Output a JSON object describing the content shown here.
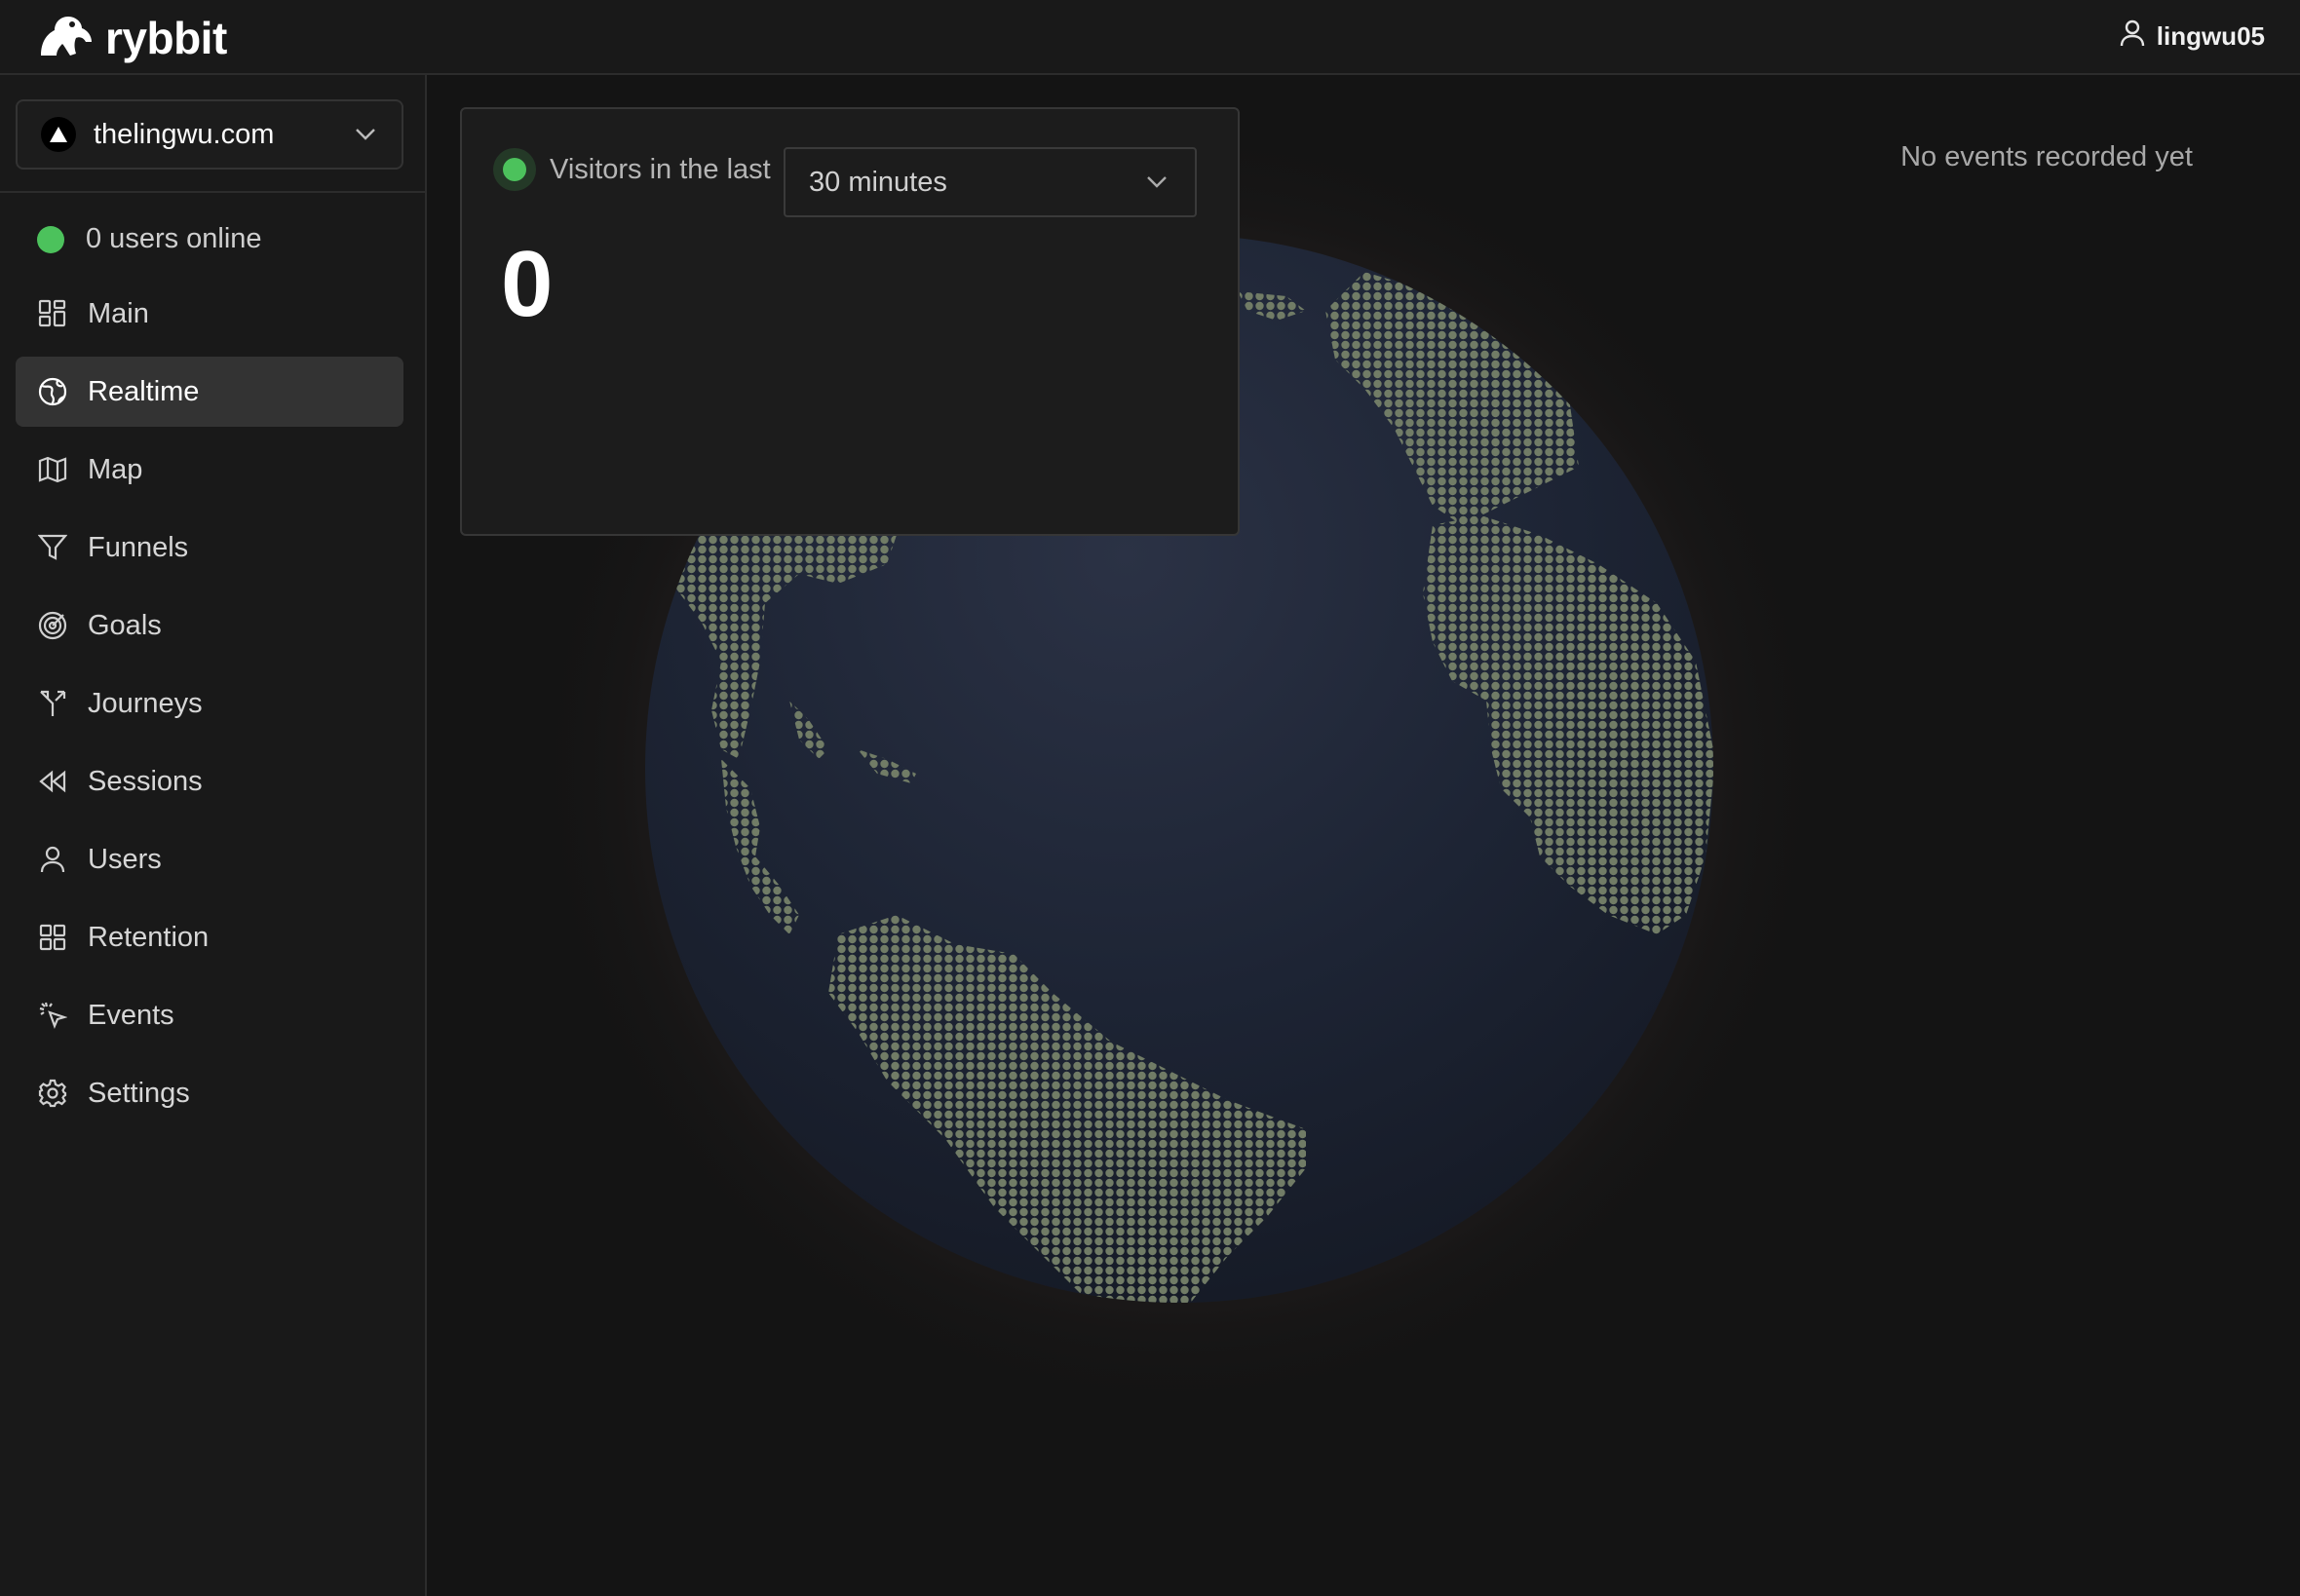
{
  "app": {
    "name": "rybbit"
  },
  "header": {
    "username": "lingwu05"
  },
  "sidebar": {
    "site": {
      "name": "thelingwu.com"
    },
    "online_text": "0 users online",
    "items": [
      {
        "label": "Main",
        "icon": "grid-icon"
      },
      {
        "label": "Realtime",
        "icon": "globe-icon",
        "active": true
      },
      {
        "label": "Map",
        "icon": "map-icon"
      },
      {
        "label": "Funnels",
        "icon": "funnel-icon"
      },
      {
        "label": "Goals",
        "icon": "target-icon"
      },
      {
        "label": "Journeys",
        "icon": "split-icon"
      },
      {
        "label": "Sessions",
        "icon": "rewind-icon"
      },
      {
        "label": "Users",
        "icon": "user-icon"
      },
      {
        "label": "Retention",
        "icon": "grid-icon"
      },
      {
        "label": "Events",
        "icon": "pointer-click-icon"
      },
      {
        "label": "Settings",
        "icon": "gear-icon"
      }
    ]
  },
  "realtime": {
    "visitors_label": "Visitors in the last",
    "range": "30 minutes",
    "count": "0",
    "no_events_text": "No events recorded yet"
  },
  "colors": {
    "background": "#141414",
    "panel": "#191919",
    "online_green": "#4cc25c",
    "globe_ocean": "#1e2535",
    "land_dots": "#6e7a62"
  }
}
